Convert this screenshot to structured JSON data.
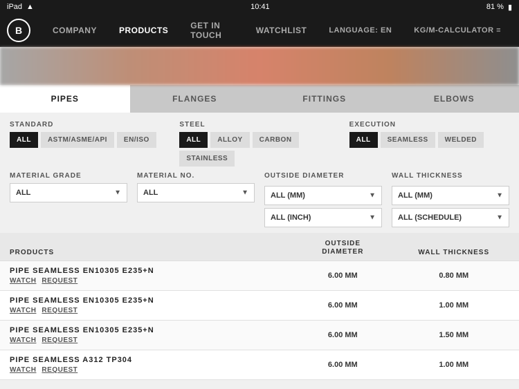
{
  "statusBar": {
    "left": "iPad",
    "time": "10:41",
    "battery": "81 %",
    "wifiIcon": "wifi",
    "batteryIcon": "battery"
  },
  "nav": {
    "logo": "B",
    "links": [
      {
        "id": "company",
        "label": "COMPANY",
        "active": false
      },
      {
        "id": "products",
        "label": "PRODUCTS",
        "active": true
      },
      {
        "id": "get-in-touch",
        "label": "GET IN TOUCH",
        "active": false
      },
      {
        "id": "watchlist",
        "label": "WATCHLIST",
        "active": false
      }
    ],
    "rightLinks": [
      {
        "id": "language",
        "label": "LANGUAGE: EN",
        "active": false
      },
      {
        "id": "calculator",
        "label": "KG/M-CALCULATOR ≡",
        "active": false
      }
    ]
  },
  "tabs": [
    {
      "id": "pipes",
      "label": "PIPES",
      "active": true
    },
    {
      "id": "flanges",
      "label": "FLANGES",
      "active": false
    },
    {
      "id": "fittings",
      "label": "FITTINGS",
      "active": false
    },
    {
      "id": "elbows",
      "label": "ELBOWS",
      "active": false
    }
  ],
  "filters": {
    "standard": {
      "label": "STANDARD",
      "buttons": [
        {
          "id": "all",
          "label": "ALL",
          "active": true
        },
        {
          "id": "astm",
          "label": "ASTM/ASME/API",
          "active": false
        },
        {
          "id": "en-iso",
          "label": "EN/ISO",
          "active": false
        }
      ]
    },
    "steel": {
      "label": "STEEL",
      "buttons": [
        {
          "id": "all",
          "label": "ALL",
          "active": true
        },
        {
          "id": "alloy",
          "label": "ALLOY",
          "active": false
        },
        {
          "id": "carbon",
          "label": "CARBON",
          "active": false
        },
        {
          "id": "stainless",
          "label": "STAINLESS",
          "active": false
        }
      ]
    },
    "execution": {
      "label": "EXECUTION",
      "buttons": [
        {
          "id": "all",
          "label": "ALL",
          "active": true
        },
        {
          "id": "seamless",
          "label": "SEAMLESS",
          "active": false
        },
        {
          "id": "welded",
          "label": "WELDED",
          "active": false
        }
      ]
    },
    "materialGrade": {
      "label": "MATERIAL GRADE",
      "placeholder": "ALL",
      "options": [
        "ALL"
      ]
    },
    "materialNo": {
      "label": "MATERIAL NO.",
      "placeholder": "ALL",
      "options": [
        "ALL"
      ]
    },
    "outsideDiameter": {
      "label": "OUTSIDE DIAMETER",
      "placeholder": "ALL (MM)",
      "placeholder2": "ALL (INCH)",
      "options": [
        "ALL (MM)",
        "ALL (INCH)"
      ]
    },
    "wallThickness": {
      "label": "WALL THICKNESS",
      "placeholder": "ALL (MM)",
      "placeholder2": "ALL (SCHEDULE)",
      "options": [
        "ALL (MM)",
        "ALL (SCHEDULE)"
      ]
    }
  },
  "table": {
    "headers": {
      "products": "PRODUCTS",
      "outsideDiameter": "OUTSIDE DIAMETER",
      "wallThickness": "WALL THICKNESS"
    },
    "rows": [
      {
        "name": "PIPE SEAMLESS EN10305 E235+N",
        "actions": [
          "WATCH",
          "REQUEST"
        ],
        "outsideDiameter": "6.00 MM",
        "wallThickness": "0.80 MM"
      },
      {
        "name": "PIPE SEAMLESS EN10305 E235+N",
        "actions": [
          "WATCH",
          "REQUEST"
        ],
        "outsideDiameter": "6.00 MM",
        "wallThickness": "1.00 MM"
      },
      {
        "name": "PIPE SEAMLESS EN10305 E235+N",
        "actions": [
          "WATCH",
          "REQUEST"
        ],
        "outsideDiameter": "6.00 MM",
        "wallThickness": "1.50 MM"
      },
      {
        "name": "PIPE SEAMLESS A312 TP304",
        "actions": [
          "WATCH",
          "REQUEST"
        ],
        "outsideDiameter": "6.00 MM",
        "wallThickness": "1.00 MM"
      }
    ]
  }
}
